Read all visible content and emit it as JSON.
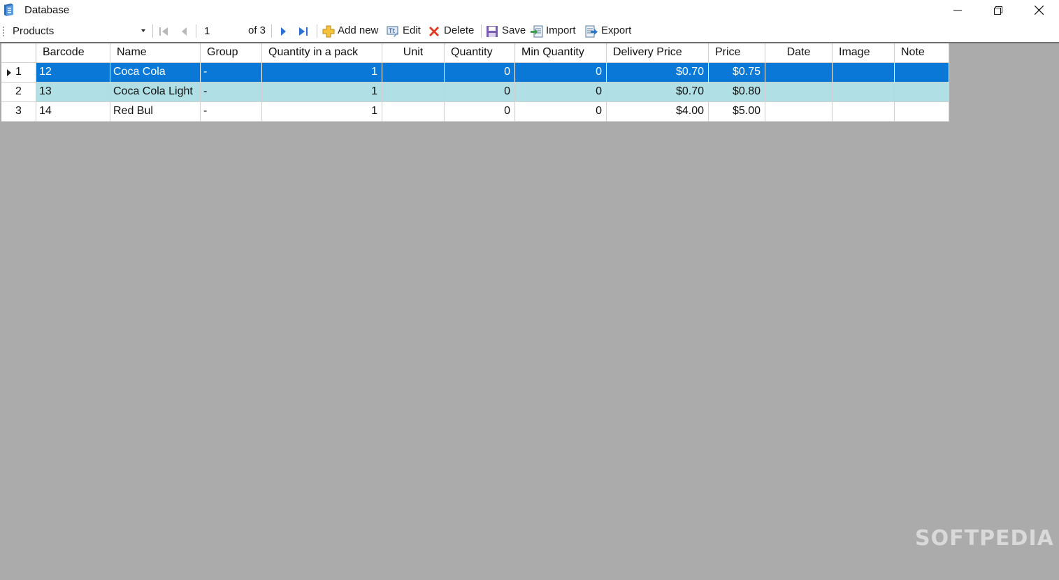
{
  "window": {
    "title": "Database"
  },
  "toolbar": {
    "table_select": "Products",
    "position": "1",
    "count": "of 3",
    "add_new": "Add new",
    "edit": "Edit",
    "delete": "Delete",
    "save": "Save",
    "import": "Import",
    "export": "Export"
  },
  "grid": {
    "columns": [
      "Barcode",
      "Name",
      "Group",
      "Quantity in a pack",
      "Unit",
      "Quantity",
      "Min Quantity",
      "Delivery Price",
      "Price",
      "Date",
      "Image",
      "Note"
    ],
    "rows": [
      {
        "row_num": "1",
        "cells": [
          "12",
          "Coca Cola",
          "-",
          "1",
          "",
          "0",
          "0",
          "$0.70",
          "$0.75",
          "",
          "",
          ""
        ]
      },
      {
        "row_num": "2",
        "cells": [
          "13",
          "Coca Cola Light",
          "-",
          "1",
          "",
          "0",
          "0",
          "$0.70",
          "$0.80",
          "",
          "",
          ""
        ]
      },
      {
        "row_num": "3",
        "cells": [
          "14",
          "Red Bul",
          "-",
          "1",
          "",
          "0",
          "0",
          "$4.00",
          "$5.00",
          "",
          "",
          ""
        ]
      }
    ],
    "selected_row": 0,
    "colors": {
      "selected": "#0a78d7",
      "alternate": "#b0dfe5"
    }
  },
  "watermark": "SOFTPEDIA"
}
